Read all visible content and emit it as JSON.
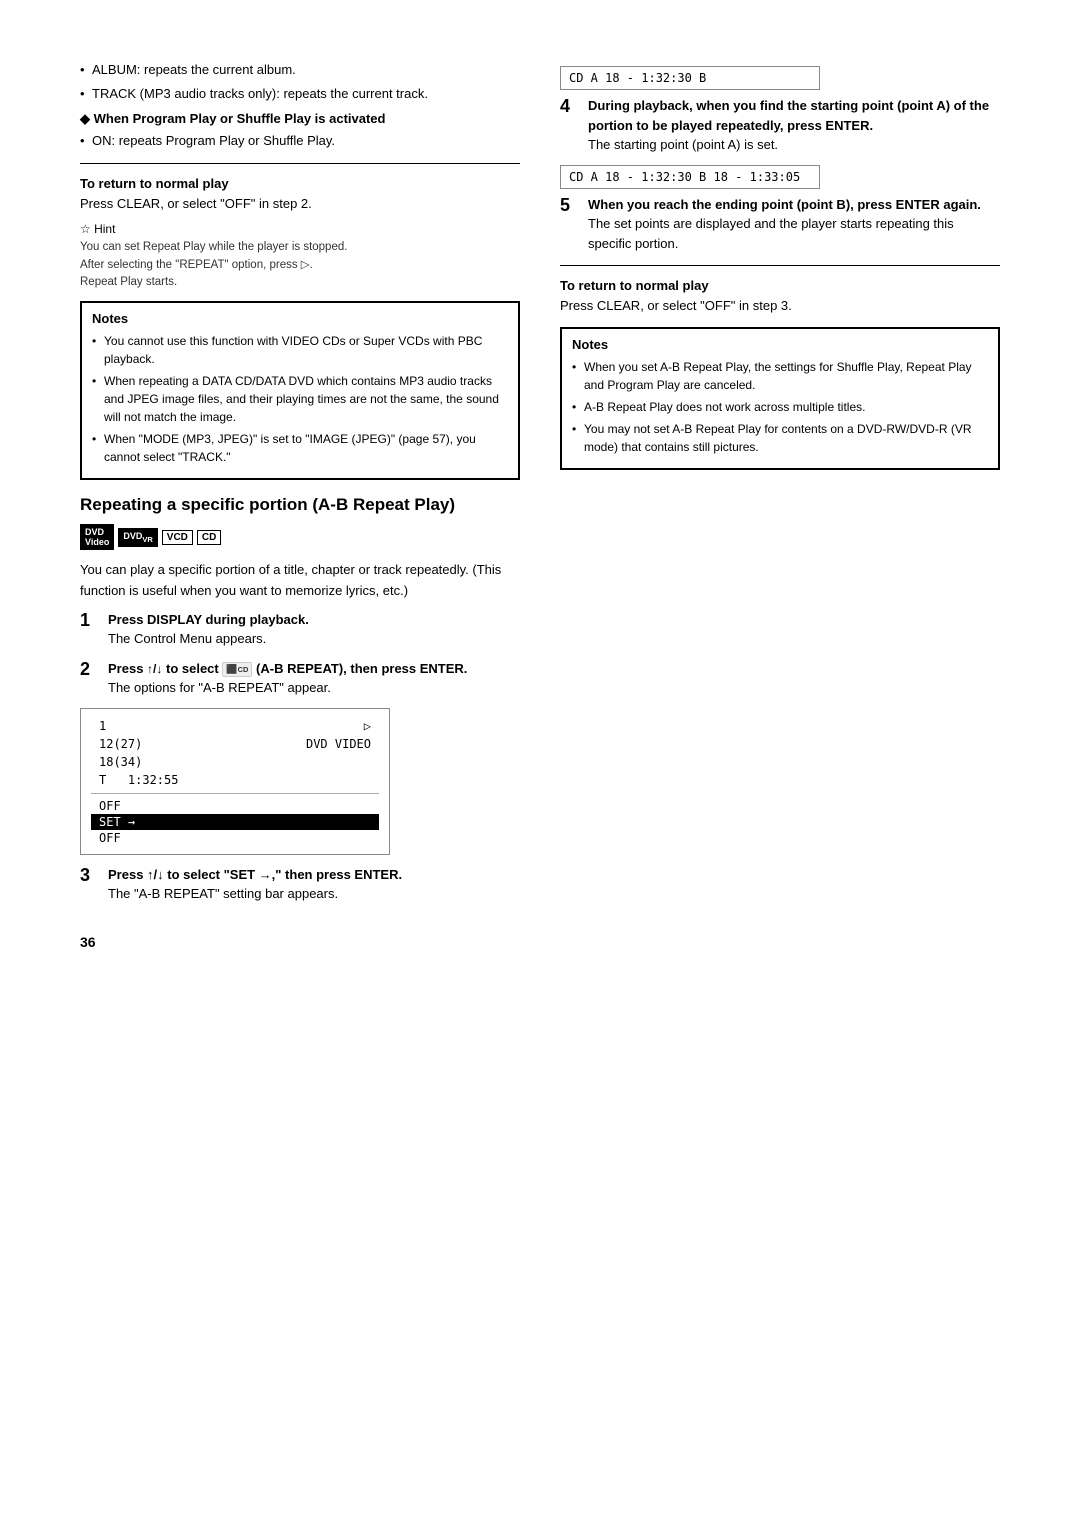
{
  "page": {
    "number": "36"
  },
  "left_col": {
    "bullets_top": [
      "ALBUM: repeats the current album.",
      "TRACK (MP3 audio tracks only): repeats the current track."
    ],
    "program_shuffle_heading": "When Program Play or Shuffle Play is activated",
    "program_shuffle_bullets": [
      "ON: repeats Program Play or Shuffle Play."
    ],
    "to_return_heading": "To return to normal play",
    "to_return_text": "Press CLEAR, or select \"OFF\" in step 2.",
    "hint_heading": "Hint",
    "hint_lines": [
      "You can set Repeat Play while the player is stopped.",
      "After selecting the \"REPEAT\" option, press ▷.",
      "Repeat Play starts."
    ],
    "notes_title": "Notes",
    "notes_bullets": [
      "You cannot use this function with VIDEO CDs or Super VCDs with PBC playback.",
      "When repeating a DATA CD/DATA DVD which contains MP3 audio tracks and JPEG image files, and their playing times are not the same, the sound will not match the image.",
      "When \"MODE (MP3, JPEG)\" is set to \"IMAGE (JPEG)\" (page 57), you cannot select \"TRACK.\""
    ],
    "section_title": "Repeating a specific portion (A-B Repeat Play)",
    "badges": [
      "DVDVideo",
      "DVDvr",
      "VCD",
      "CD"
    ],
    "body_text": "You can play a specific portion of a title, chapter or track repeatedly. (This function is useful when you want to memorize lyrics, etc.)",
    "steps": [
      {
        "number": "1",
        "bold": "Press DISPLAY during playback.",
        "desc": "The Control Menu appears."
      },
      {
        "number": "2",
        "bold": "Press ↑/↓ to select  (A-B REPEAT), then press ENTER.",
        "desc": "The options for \"A-B REPEAT\" appear."
      },
      {
        "number": "3",
        "bold": "Press ↑/↓ to select \"SET →,\" then press ENTER.",
        "desc": "The \"A-B REPEAT\" setting bar appears."
      }
    ],
    "screen_menu": {
      "rows": [
        {
          "left": "1",
          "right": ""
        },
        {
          "left": "12(27)",
          "right": "DVD VIDEO"
        },
        {
          "left": "18(34)",
          "right": ""
        },
        {
          "left": "T   1:32:55",
          "right": ""
        }
      ],
      "options": [
        "OFF",
        "SET →",
        "OFF"
      ],
      "selected": "SET →"
    }
  },
  "right_col": {
    "step4": {
      "number": "4",
      "bold": "During playback, when you find the starting point (point A) of the portion to be played repeatedly, press ENTER.",
      "desc": "The starting point (point A) is set."
    },
    "screen_a": {
      "content": "CD  A 18 - 1:32:30  B"
    },
    "screen_ab": {
      "content": "CD  A 18 - 1:32:30  B 18 - 1:33:05"
    },
    "step5": {
      "number": "5",
      "bold": "When you reach the ending point (point B), press ENTER again.",
      "desc": "The set points are displayed and the player starts repeating this specific portion."
    },
    "to_return_heading": "To return to normal play",
    "to_return_text": "Press CLEAR, or select \"OFF\" in step 3.",
    "notes_title": "Notes",
    "notes_bullets": [
      "When you set A-B Repeat Play, the settings for Shuffle Play, Repeat Play and Program Play are canceled.",
      "A-B Repeat Play does not work across multiple titles.",
      "You may not set A-B Repeat Play for contents on a DVD-RW/DVD-R (VR mode) that contains still pictures."
    ]
  }
}
